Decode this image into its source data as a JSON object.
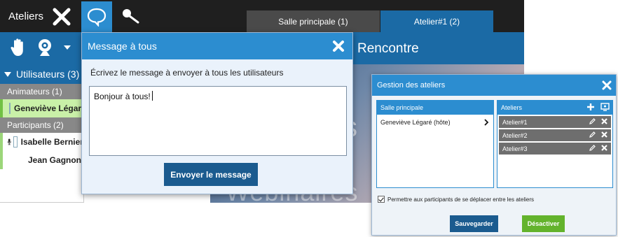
{
  "app": {
    "title": "Ateliers"
  },
  "top_icons": [
    "close-icon",
    "chat-icon",
    "microphone-icon"
  ],
  "tabs": [
    {
      "label": "Salle principale (1)"
    },
    {
      "label": "Atelier#1 (2)"
    }
  ],
  "toolbar": {
    "icons": [
      "raise-hand-icon",
      "webcam-icon",
      "dropdown-arrow-icon"
    ]
  },
  "room": {
    "title": "Rencontre"
  },
  "users": {
    "header": "Utilisateurs (3)",
    "groups": [
      {
        "label": "Animateurs (1)",
        "members": [
          "Geneviève Légaré"
        ]
      },
      {
        "label": "Participants (2)",
        "members": [
          "Isabelle Bernier",
          "Jean Gagnon"
        ]
      }
    ]
  },
  "video": {
    "big_text": "Webinaires",
    "side_text": "s"
  },
  "message_dialog": {
    "title": "Message à tous",
    "label": "Écrivez le message à envoyer à tous les utilisateurs",
    "text": "Bonjour à tous!",
    "send_label": "Envoyer le message"
  },
  "ateliers_dialog": {
    "title": "Gestion des ateliers",
    "main_room_header": "Salle principale",
    "main_room_user": "Geneviève Légaré (hôte)",
    "ateliers_header": "Ateliers",
    "ateliers": [
      "Atelier#1",
      "Atelier#2",
      "Atelier#3"
    ],
    "permit_label": "Permettre aux participants de se déplacer entre les ateliers",
    "save_label": "Sauvegarder",
    "deactivate_label": "Désactiver"
  },
  "colors": {
    "accent": "#2c8dd0",
    "dark_blue": "#1b6aa5",
    "green": "#63b32c"
  }
}
